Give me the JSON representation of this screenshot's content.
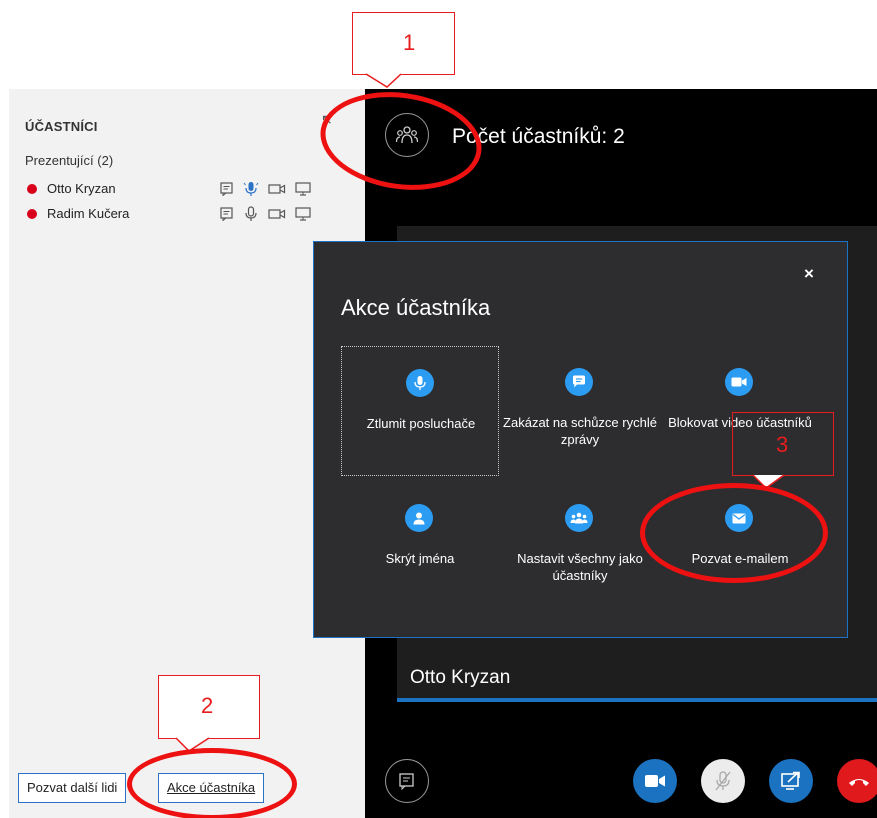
{
  "participants_panel": {
    "title": "ÚČASTNÍCI",
    "group_label": "Prezentující (2)",
    "participants": [
      {
        "name": "Otto Kryzan",
        "status_color": "#d9001b",
        "mic_active": true
      },
      {
        "name": "Radim Kučera",
        "status_color": "#d9001b",
        "mic_active": false
      }
    ],
    "invite_button": "Pozvat další lidi",
    "actions_button": "Akce účastníka"
  },
  "meeting": {
    "participant_count": "Počet účastníků: 2",
    "video_name": "Otto Kryzan",
    "controls": [
      "video-icon",
      "mic-muted-icon",
      "share-screen-icon",
      "hangup-icon"
    ]
  },
  "popup": {
    "title": "Akce účastníka",
    "close_label": "×",
    "actions": [
      {
        "label": "Ztlumit posluchače",
        "icon": "microphone-icon"
      },
      {
        "label": "Zakázat na schůzce rychlé zprávy",
        "icon": "chat-icon"
      },
      {
        "label": "Blokovat video účastníků",
        "icon": "video-icon"
      },
      {
        "label": "Skrýt jména",
        "icon": "person-icon"
      },
      {
        "label": "Nastavit všechny jako účastníky",
        "icon": "group-icon"
      },
      {
        "label": "Pozvat e-mailem",
        "icon": "mail-icon"
      }
    ]
  },
  "annotations": {
    "callout_1": "1",
    "callout_2": "2",
    "callout_3": "3",
    "color": "#e81c1c"
  },
  "colors": {
    "accent_blue": "#1b72c0",
    "icon_blue": "#2c9cf2",
    "hangup_red": "#e0191d"
  }
}
